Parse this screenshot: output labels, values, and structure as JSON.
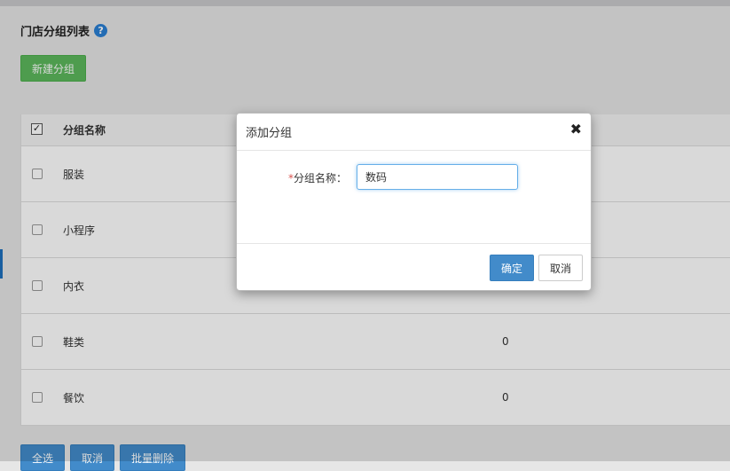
{
  "page": {
    "title": "门店分组列表",
    "help_icon": "?",
    "new_button": "新建分组"
  },
  "table": {
    "header": {
      "name": "分组名称"
    },
    "rows": [
      {
        "name": "服装",
        "count": ""
      },
      {
        "name": "小程序",
        "count": ""
      },
      {
        "name": "内衣",
        "count": ""
      },
      {
        "name": "鞋类",
        "count": "0"
      },
      {
        "name": "餐饮",
        "count": "0"
      }
    ]
  },
  "bottom_actions": {
    "select_all": "全选",
    "cancel": "取消",
    "batch_delete": "批量删除"
  },
  "modal": {
    "title": "添加分组",
    "close": "✖",
    "required_mark": "*",
    "field_label": "分组名称：",
    "field_value": "数码",
    "ok_label": "确定",
    "cancel_label": "取消"
  },
  "colors": {
    "primary": "#428bca",
    "success": "#5cb85c",
    "danger": "#d9534f"
  }
}
